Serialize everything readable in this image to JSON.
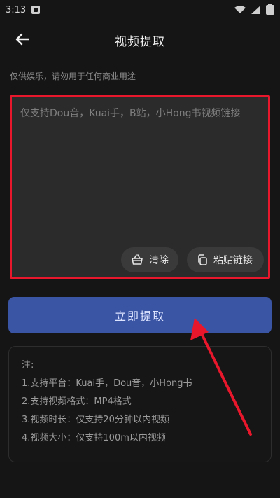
{
  "status_bar": {
    "time": "3:13"
  },
  "header": {
    "title": "视频提取"
  },
  "disclaimer": "仅供娱乐，请勿用于任何商业用途",
  "input": {
    "placeholder": "仅支持Dou音，Kuai手，B站，小Hong书视频链接",
    "value": ""
  },
  "buttons": {
    "clear_label": "清除",
    "paste_label": "粘贴链接",
    "extract_label": "立即提取"
  },
  "notes": {
    "title": "注:",
    "items": [
      "1.支持平台：Kuai手，Dou音，小Hong书",
      "2.支持视频格式：MP4格式",
      "3.视频时长：仅支持20分钟以内视频",
      "4.视频大小：仅支持100m以内视频"
    ]
  },
  "colors": {
    "background": "#151515",
    "input_border": "#e8172b",
    "primary_button": "#3b55a5",
    "annotation_arrow": "#e8172b"
  },
  "icons": {
    "back": "arrow-left-icon",
    "clear": "basket-icon",
    "paste": "copy-icon"
  }
}
